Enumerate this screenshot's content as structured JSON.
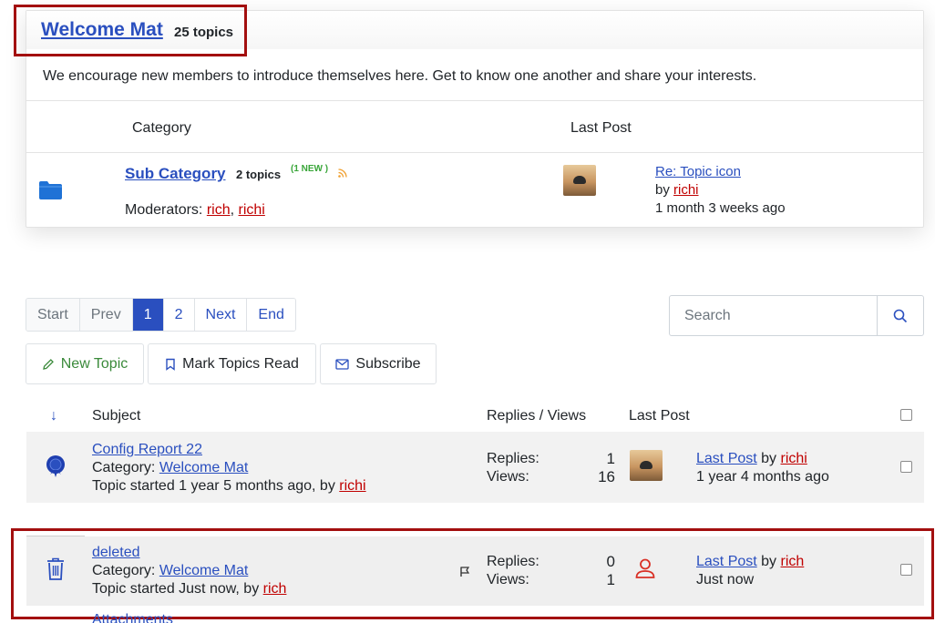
{
  "category": {
    "title": "Welcome Mat",
    "topic_count": "25 topics",
    "description": "We encourage new members to introduce themselves here. Get to know one another and share your interests.",
    "col_category": "Category",
    "col_last_post": "Last Post",
    "subcategory": {
      "title": "Sub Category",
      "topic_count": "2 topics",
      "new_badge": "(1 NEW )",
      "moderators_label": "Moderators:",
      "moderators": [
        "rich",
        "richi"
      ],
      "sep": ",",
      "last_post_title": "Re: Topic icon",
      "by_label": "by",
      "last_post_author": "richi",
      "last_post_time": "1 month 3 weeks ago"
    }
  },
  "pagination": {
    "items": [
      "Start",
      "Prev",
      "1",
      "2",
      "Next",
      "End"
    ],
    "current": "1"
  },
  "search": {
    "placeholder": "Search"
  },
  "actions": {
    "new_topic": "New Topic",
    "mark_read": "Mark Topics Read",
    "subscribe": "Subscribe"
  },
  "topics_table": {
    "sort_icon": "↓",
    "headers": {
      "subject": "Subject",
      "replies_views": "Replies / Views",
      "last_post": "Last Post"
    },
    "rows": [
      {
        "title": "Config Report 22",
        "category_label": "Category:",
        "category": "Welcome Mat",
        "started_prefix": "Topic started 1 year 5 months ago, by",
        "started_by": "richi",
        "replies_label": "Replies:",
        "replies": "1",
        "views_label": "Views:",
        "views": "16",
        "last_post_link": "Last Post",
        "by_label": "by",
        "last_post_author": "richi",
        "last_post_time": "1 year 4 months ago",
        "icon": "ribbon-icon"
      },
      {
        "title": "deleted",
        "category_label": "Category:",
        "category": "Welcome Mat",
        "started_prefix": "Topic started Just now, by",
        "started_by": "rich",
        "replies_label": "Replies:",
        "replies": "0",
        "views_label": "Views:",
        "views": "1",
        "last_post_link": "Last Post",
        "by_label": "by",
        "last_post_author": "rich",
        "last_post_time": "Just now",
        "icon": "trash-icon"
      }
    ],
    "next_row_partial": "Attachments"
  },
  "colors": {
    "link": "#2a4fbf",
    "user_link": "#c00000",
    "highlight": "#a30f0f",
    "new_green": "#3aa63a"
  }
}
